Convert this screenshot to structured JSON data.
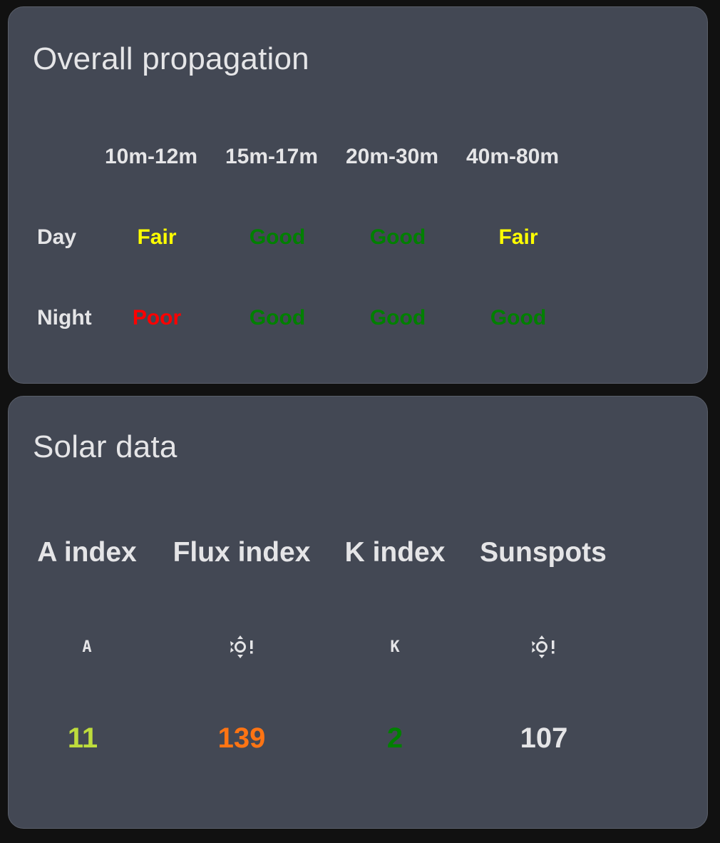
{
  "propagation": {
    "title": "Overall propagation",
    "bands": [
      "10m-12m",
      "15m-17m",
      "20m-30m",
      "40m-80m"
    ],
    "rows": [
      {
        "label": "Day",
        "conditions": [
          {
            "value": "Fair",
            "color": "#ffff00"
          },
          {
            "value": "Good",
            "color": "#008000"
          },
          {
            "value": "Good",
            "color": "#008000"
          },
          {
            "value": "Fair",
            "color": "#ffff00"
          }
        ]
      },
      {
        "label": "Night",
        "conditions": [
          {
            "value": "Poor",
            "color": "#ff0000"
          },
          {
            "value": "Good",
            "color": "#008000"
          },
          {
            "value": "Good",
            "color": "#008000"
          },
          {
            "value": "Good",
            "color": "#008000"
          }
        ]
      }
    ]
  },
  "solar": {
    "title": "Solar data",
    "items": [
      {
        "label": "A index",
        "icon": "alpha-a-icon",
        "icon_glyph": "A",
        "value": "11",
        "color": "#bedc3c"
      },
      {
        "label": "Flux index",
        "icon": "sun-alert-icon",
        "icon_glyph": "",
        "value": "139",
        "color": "#ff7413"
      },
      {
        "label": "K index",
        "icon": "alpha-k-icon",
        "icon_glyph": "K",
        "value": "2",
        "color": "#008000"
      },
      {
        "label": "Sunspots",
        "icon": "sun-alert-icon",
        "icon_glyph": "",
        "value": "107",
        "color": "#e5e5e7"
      }
    ]
  }
}
